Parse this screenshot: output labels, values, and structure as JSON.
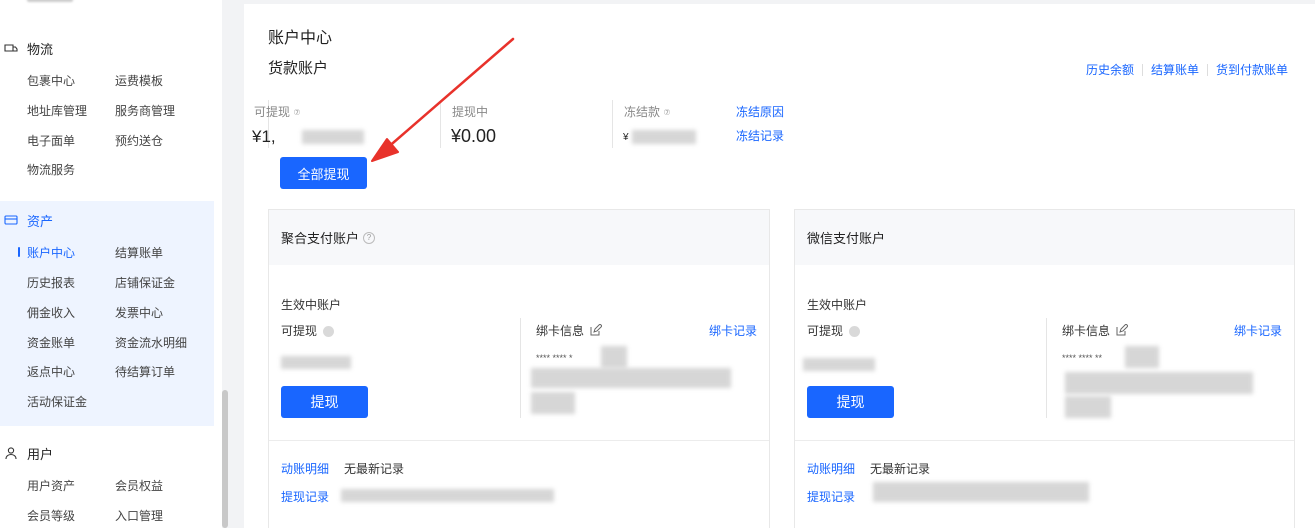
{
  "sidebar": {
    "logistics": {
      "title": "物流",
      "items": [
        "包裹中心",
        "运费模板",
        "地址库管理",
        "服务商管理",
        "电子面单",
        "预约送仓",
        "物流服务"
      ]
    },
    "assets": {
      "title": "资产",
      "items": [
        "账户中心",
        "结算账单",
        "历史报表",
        "店铺保证金",
        "佣金收入",
        "发票中心",
        "资金账单",
        "资金流水明细",
        "返点中心",
        "待结算订单",
        "活动保证金"
      ],
      "active": "账户中心"
    },
    "users": {
      "title": "用户",
      "items": [
        "用户资产",
        "会员权益",
        "会员等级",
        "入口管理"
      ]
    }
  },
  "main": {
    "page_title": "账户中心",
    "section_title": "货款账户",
    "top_links": [
      "历史余额",
      "结算账单",
      "货到付款账单"
    ],
    "summary": {
      "withdrawable_label": "可提现",
      "withdrawable_value": "¥1,",
      "withdrawing_label": "提现中",
      "withdrawing_value": "¥0.00",
      "frozen_label": "冻结款",
      "frozen_value": "¥",
      "frozen_reason": "冻结原因",
      "frozen_record": "冻结记录"
    },
    "withdraw_all_button": "全部提现"
  },
  "cards": [
    {
      "title": "聚合支付账户",
      "effective_label": "生效中账户",
      "withdrawable_label": "可提现",
      "card_info_label": "绑卡信息",
      "card_record_link": "绑卡记录",
      "card_number_mask": "**** **** *",
      "withdraw_button": "提现",
      "flow_detail_link": "动账明细",
      "no_record_text": "无最新记录",
      "withdraw_record_link": "提现记录"
    },
    {
      "title": "微信支付账户",
      "effective_label": "生效中账户",
      "withdrawable_label": "可提现",
      "card_info_label": "绑卡信息",
      "card_record_link": "绑卡记录",
      "card_number_mask": "**** **** **",
      "withdraw_button": "提现",
      "flow_detail_link": "动账明细",
      "no_record_text": "无最新记录",
      "withdraw_record_link": "提现记录"
    }
  ],
  "colors": {
    "accent": "#1966ff",
    "arrow": "#e8322b",
    "sidebar_active_bg": "#eef4ff"
  },
  "icons": [
    "truck-icon",
    "wallet-icon",
    "user-icon",
    "question-icon",
    "edit-icon",
    "info-icon"
  ]
}
